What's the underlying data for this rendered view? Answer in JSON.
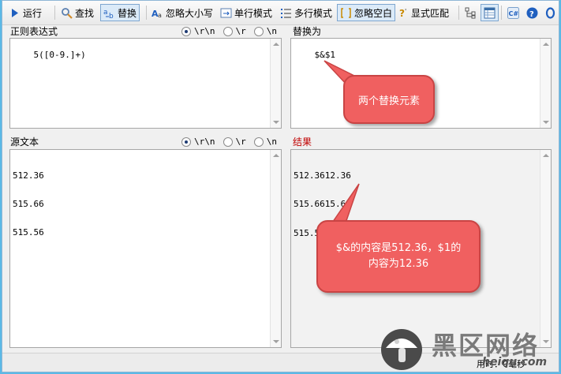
{
  "toolbar": {
    "run": "运行",
    "find": "查找",
    "replace": "替换",
    "ignore_case": "忽略大小写",
    "single_line": "单行模式",
    "multi_line": "多行模式",
    "ignore_whitespace": "忽略空白",
    "explicit_match": "显式匹配"
  },
  "regex_pane": {
    "label": "正则表达式",
    "value": "5([0-9.]+)",
    "options": [
      "\\r\\n",
      "\\r",
      "\\n"
    ],
    "selected": 0
  },
  "replace_pane": {
    "label": "替换为",
    "value": "$&$1"
  },
  "source_pane": {
    "label": "源文本",
    "lines": [
      "512.36",
      "515.66",
      "515.56"
    ],
    "options": [
      "\\r\\n",
      "\\r",
      "\\n"
    ],
    "selected": 0
  },
  "result_pane": {
    "label": "结果",
    "lines": [
      "512.3612.36",
      "515.6615.66",
      "515.5615.56"
    ]
  },
  "callouts": {
    "top": "两个替换元素",
    "bottom": "$&的内容是512.36，$1的内容为12.36"
  },
  "status": {
    "elapsed": "用时：0毫秒"
  },
  "watermark": {
    "cn": "黑区网络",
    "en": "heiqu.com"
  },
  "colors": {
    "accent_blue": "#1f5fbf",
    "callout_fill": "#f06060",
    "result_label": "#c00000"
  }
}
